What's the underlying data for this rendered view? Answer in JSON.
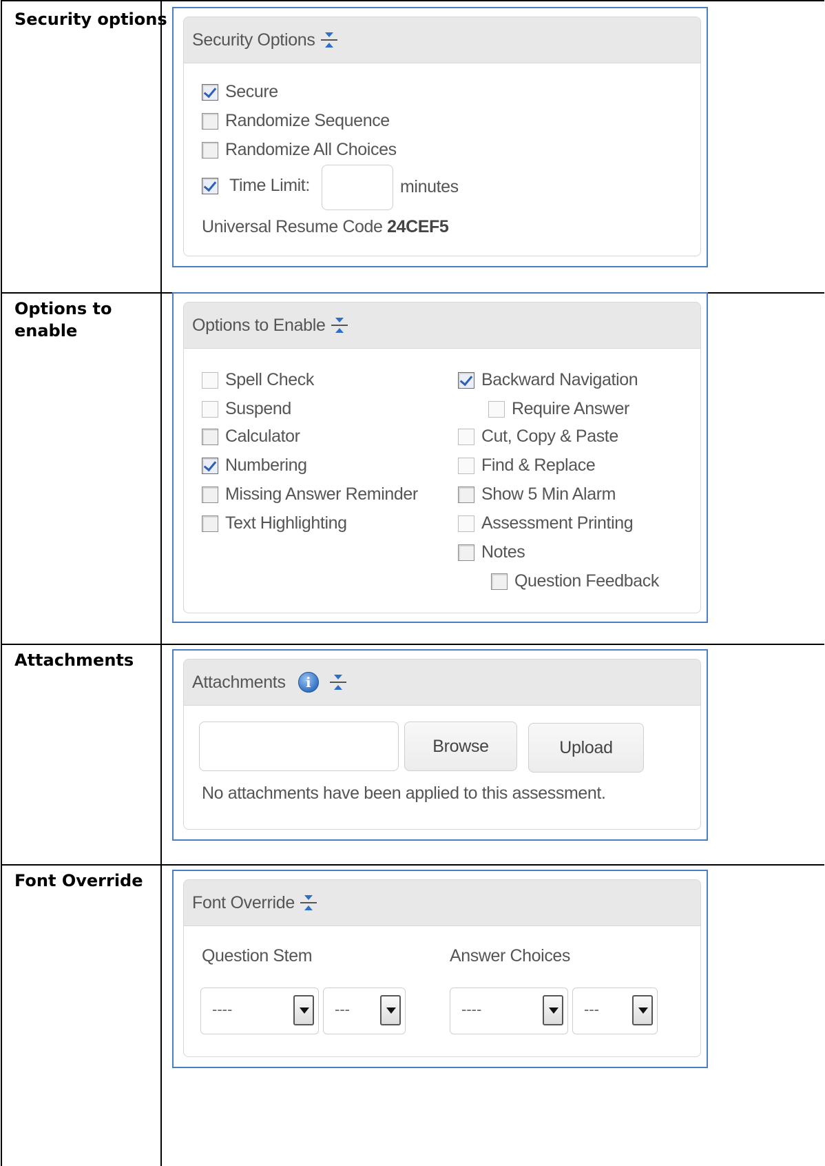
{
  "rows": [
    {
      "label": "Security options"
    },
    {
      "label": "Options to enable"
    },
    {
      "label": "Attachments"
    },
    {
      "label": "Font Override"
    }
  ],
  "security": {
    "title": "Security Options",
    "secure": {
      "label": "Secure",
      "checked": true
    },
    "randomize_sequence": {
      "label": "Randomize Sequence",
      "checked": false
    },
    "randomize_all_choices": {
      "label": "Randomize All Choices",
      "checked": false
    },
    "time_limit": {
      "label": "Time Limit:",
      "checked": true,
      "value": "",
      "unit": "minutes"
    },
    "resume_code": {
      "label": "Universal Resume Code",
      "value": "24CEF5"
    }
  },
  "options": {
    "title": "Options to Enable",
    "left": [
      {
        "label": "Spell Check",
        "checked": false
      },
      {
        "label": "Suspend",
        "checked": false
      },
      {
        "label": "Calculator",
        "checked": false
      },
      {
        "label": "Numbering",
        "checked": true
      },
      {
        "label": "Missing Answer Reminder",
        "checked": false
      },
      {
        "label": "Text Highlighting",
        "checked": false
      }
    ],
    "right": [
      {
        "label": "Backward Navigation",
        "checked": true
      },
      {
        "label": "Require Answer",
        "checked": false
      },
      {
        "label": "Cut, Copy & Paste",
        "checked": false
      },
      {
        "label": "Find & Replace",
        "checked": false
      },
      {
        "label": "Show 5 Min Alarm",
        "checked": false
      },
      {
        "label": "Assessment Printing",
        "checked": false
      },
      {
        "label": "Notes",
        "checked": false
      },
      {
        "label": "Question Feedback",
        "checked": false
      }
    ]
  },
  "attachments": {
    "title": "Attachments",
    "file_value": "",
    "browse_label": "Browse",
    "upload_label": "Upload",
    "empty_message": "No attachments have been applied to this assessment."
  },
  "font_override": {
    "title": "Font Override",
    "question_stem_label": "Question Stem",
    "answer_choices_label": "Answer Choices",
    "stem_font": "----",
    "stem_size": "---",
    "choices_font": "----",
    "choices_size": "---"
  }
}
